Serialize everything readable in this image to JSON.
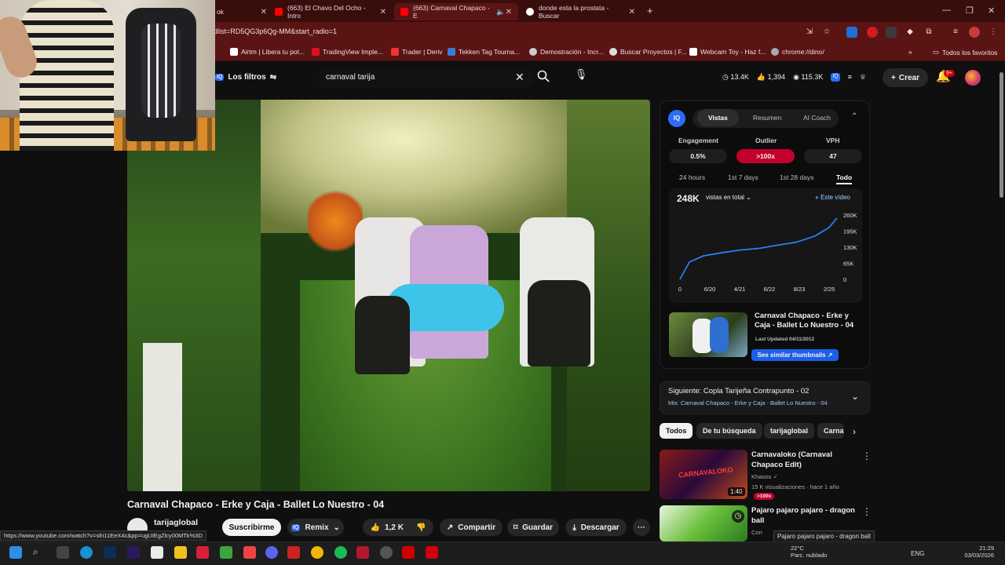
{
  "browser": {
    "tabs": [
      {
        "label": "ok",
        "active": false
      },
      {
        "label": "(663) El Chavo Del Ocho - Intro",
        "active": false
      },
      {
        "label": "(663) Carnaval Chapaco - E",
        "active": true
      },
      {
        "label": "donde esta la prostata - Buscar",
        "active": false
      }
    ],
    "new_tab": "+",
    "url": "dlist=RD5QG3p6Qg-MM&start_radio=1",
    "bookmarks": [
      "Airtm | Libera tu pot...",
      "TradingView Imple...",
      "Trader | Deriv",
      "Tekken Tag Tourna...",
      "Demostración - Incr...",
      "Buscar Proyectos | F...",
      "Webcam Toy - Haz f...",
      "chrome://dino/"
    ],
    "bookmarks_more": "»",
    "all_favorites": "Todos los favoritos",
    "status_url": "https://www.youtube.com/watch?v=sfri11EeX4c&pp=ugUIEgZlcy00MTk%3D"
  },
  "youtube": {
    "filters_label": "Los filtros",
    "search_value": "carnaval tarija",
    "stats": [
      "13.4K",
      "1,394",
      "115.3K"
    ],
    "create_label": "Crear",
    "notif_badge": "9+",
    "video_title": "Carnaval Chapaco - Erke y Caja - Ballet Lo Nuestro - 04",
    "channel": "tarijaglobal",
    "subscribe": "Suscribirme",
    "remix": "Remix",
    "likes": "1,2 K",
    "share": "Compartir",
    "save": "Guardar",
    "download": "Descargar",
    "more": "···"
  },
  "iq": {
    "logo": "IQ",
    "tabs": [
      "Vistas",
      "Resumen",
      "AI Coach"
    ],
    "metrics": [
      {
        "label": "Engagement",
        "value": "0.5%"
      },
      {
        "label": "Outlier",
        "value": ">100x"
      },
      {
        "label": "VPH",
        "value": "47"
      }
    ],
    "periods": [
      "24 hours",
      "1st 7 days",
      "1st 28 days",
      "Todo"
    ],
    "total_views": "248K",
    "views_mode": "vistas en total",
    "legend": "Este vídeo",
    "video_card_title": "Carnaval Chapaco - Erke y Caja - Ballet Lo Nuestro - 04",
    "last_updated": "Last Updated 04/11/2012",
    "similar_button": "See similar thumbnails"
  },
  "chart_data": {
    "type": "line",
    "x_ticks": [
      "0",
      "6/20",
      "4/21",
      "6/22",
      "8/23",
      "2/25"
    ],
    "y_ticks": [
      "0",
      "65K",
      "130K",
      "195K",
      "260K"
    ],
    "ylim": [
      0,
      260000
    ],
    "series": [
      {
        "name": "Este vídeo",
        "x": [
          0,
          0.06,
          0.15,
          0.27,
          0.38,
          0.5,
          0.62,
          0.74,
          0.86,
          0.95,
          1.0
        ],
        "values": [
          0,
          70000,
          95000,
          108000,
          118000,
          125000,
          138000,
          150000,
          175000,
          210000,
          248000
        ]
      }
    ],
    "color": "#2a7ef0"
  },
  "next": {
    "title": "Siguiente: Copla Tarijeña Contrapunto - 02",
    "mix": "Mix: Carnaval Chapaco - Erke y Caja - Ballet Lo Nuestro - 04"
  },
  "chips": [
    "Todos",
    "De tu búsqueda",
    "tarijaglobal",
    "Carna"
  ],
  "recs": [
    {
      "title": "Carnavaloko (Carnaval Chapaco Edit)",
      "channel": "Khaoos",
      "meta": "15 K visualizaciones · hace 1 año",
      "duration": "1:40",
      "badge": ">100x",
      "thumb_text": "CARNAVALOKO"
    },
    {
      "title": "Pajaro pajaro pajaro - dragon ball",
      "channel": "Con"
    }
  ],
  "tooltip": "Pajaro pajaro pajaro - dragon ball",
  "taskbar": {
    "weather_temp": "22°C",
    "weather_desc": "Parc. nublado",
    "lang": "ENG",
    "time": "21:29",
    "date": "03/03/2026"
  }
}
